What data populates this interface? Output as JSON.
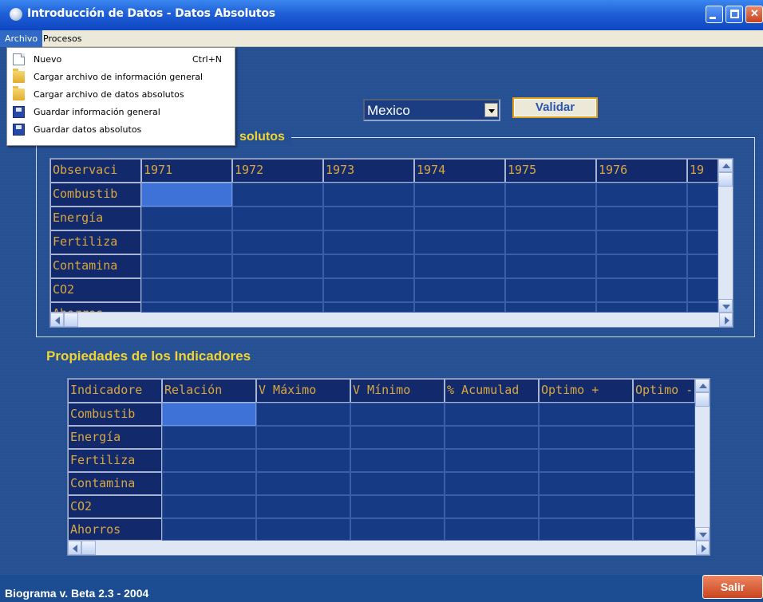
{
  "window": {
    "title": "Introducción de Datos - Datos Absolutos"
  },
  "menu": {
    "items": [
      "Archivo",
      "Procesos"
    ],
    "archivo": [
      {
        "label": "Nuevo",
        "shortcut": "Ctrl+N",
        "icon": "new-document-icon"
      },
      {
        "label": "Cargar archivo de información general",
        "shortcut": "",
        "icon": "open-folder-icon"
      },
      {
        "label": "Cargar archivo de datos absolutos",
        "shortcut": "",
        "icon": "open-folder-icon"
      },
      {
        "label": "Guardar información general",
        "shortcut": "",
        "icon": "save-disk-icon"
      },
      {
        "label": "Guardar datos absolutos",
        "shortcut": "",
        "icon": "save-disk-icon"
      }
    ]
  },
  "country": {
    "value": "Mexico"
  },
  "validar_label": "Validar",
  "section1": {
    "legend": "solutos",
    "columns": [
      "Observaci",
      "1971",
      "1972",
      "1973",
      "1974",
      "1975",
      "1976",
      "19"
    ],
    "rows": [
      "Combustib",
      "Energía",
      "Fertiliza",
      "Contamina",
      "CO2",
      "Ahorros"
    ]
  },
  "section2": {
    "title": "Propiedades de los Indicadores",
    "columns": [
      "Indicadore",
      "Relación",
      "V Máximo",
      "V Mínimo",
      "% Acumulad",
      "Optimo +",
      "Optimo -"
    ],
    "rows": [
      "Combustib",
      "Energía",
      "Fertiliza",
      "Contamina",
      "CO2",
      "Ahorros"
    ]
  },
  "footer": {
    "status": "Biograma v. Beta 2.3 - 2004",
    "exit_label": "Salir"
  },
  "colors": {
    "accent": "#f2d430",
    "panel": "#244f92",
    "grid_body": "#173a84",
    "selected": "#3f72d6"
  }
}
